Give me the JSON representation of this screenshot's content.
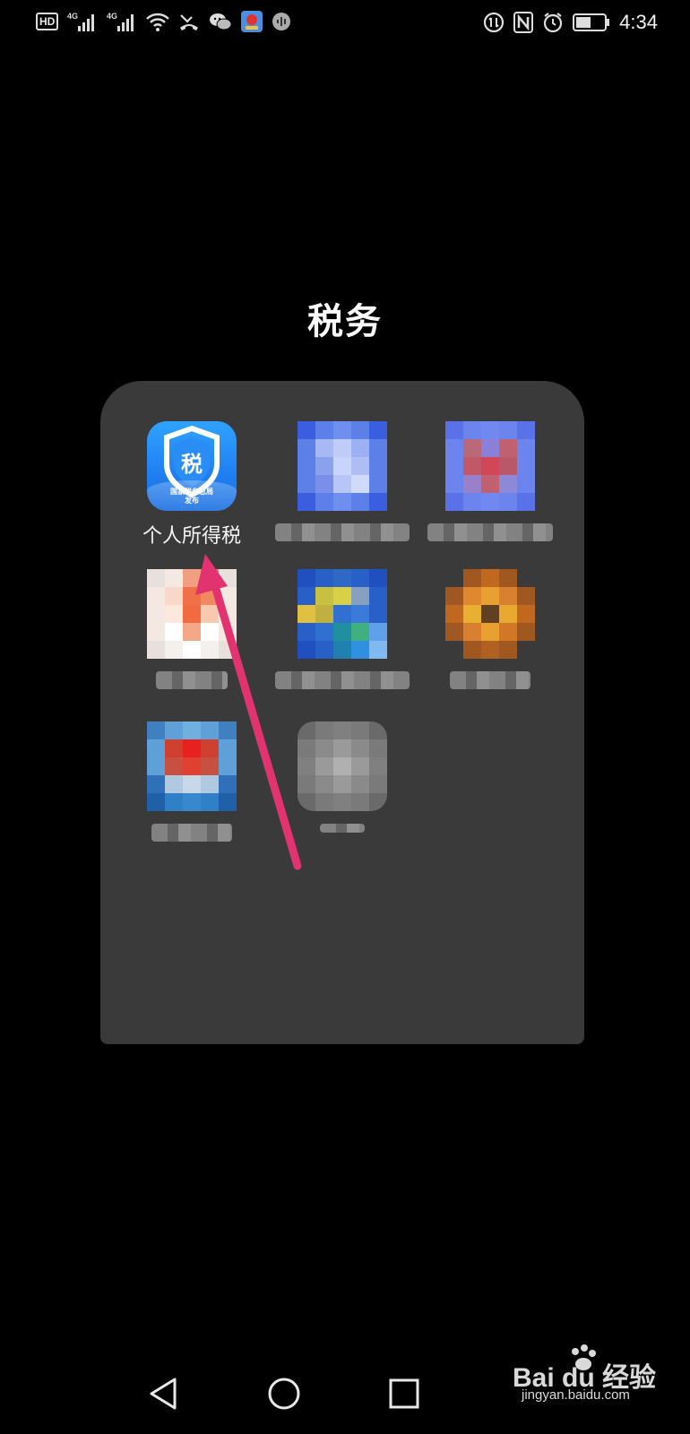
{
  "status_bar": {
    "left_icons": [
      "hd-icon",
      "signal-4g-icon",
      "signal-4g-icon-2",
      "wifi-icon",
      "missed-call-icon",
      "wechat-icon",
      "app-notification-icon",
      "voice-icon"
    ],
    "hd_label": "HD",
    "network_label_1": "4G",
    "network_label_2": "4G",
    "right_icons": [
      "data-saver-icon",
      "nfc-icon",
      "alarm-icon",
      "battery-icon"
    ],
    "time": "4:34"
  },
  "folder": {
    "title": "税务",
    "apps": [
      {
        "label": "个人所得税",
        "icon": "tax-app-icon",
        "icon_title": "税",
        "icon_caption_line1": "国家税务总局",
        "icon_caption_line2": "发布"
      },
      {
        "label": "",
        "icon": "blurred-app-icon"
      },
      {
        "label": "",
        "icon": "blurred-app-icon"
      },
      {
        "label": "",
        "icon": "blurred-app-icon"
      },
      {
        "label": "",
        "icon": "blurred-app-icon"
      },
      {
        "label": "",
        "icon": "blurred-app-icon"
      },
      {
        "label": "",
        "icon": "blurred-app-icon"
      },
      {
        "label": "",
        "icon": "blurred-app-icon"
      }
    ]
  },
  "annotation": {
    "arrow_color": "#e0336f"
  },
  "nav_bar": {
    "icons": [
      "back-icon",
      "home-icon",
      "recents-icon"
    ]
  },
  "watermark": {
    "text": "Bai du 经验",
    "sub": "jingyan.baidu.com"
  },
  "colors": {
    "background": "#000000",
    "folder_panel": "#3a3a3a",
    "tax_icon_top": "#2fa3ff",
    "tax_icon_bottom": "#1b6fe0"
  }
}
